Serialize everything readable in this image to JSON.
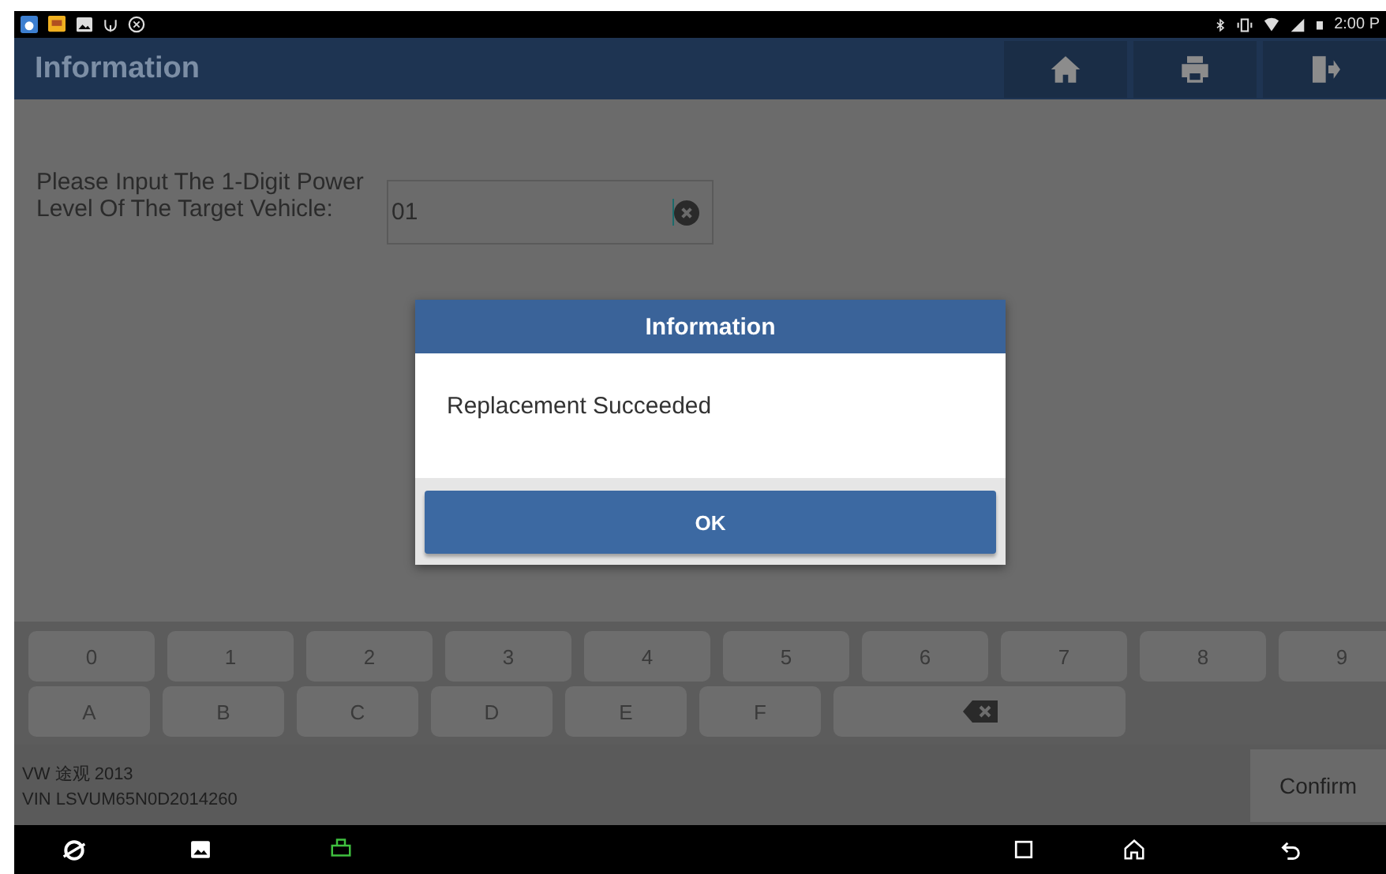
{
  "status_bar": {
    "time": "2:00 P"
  },
  "header": {
    "title": "Information"
  },
  "prompt": {
    "label": "Please Input The 1-Digit Power Level Of The Target Vehicle:",
    "value": "01"
  },
  "dialog": {
    "title": "Information",
    "message": "Replacement Succeeded",
    "button": "OK"
  },
  "keypad": {
    "rows": [
      [
        {
          "kind": "char",
          "label": "0"
        },
        {
          "kind": "char",
          "label": "1"
        },
        {
          "kind": "char",
          "label": "2"
        },
        {
          "kind": "char",
          "label": "3"
        },
        {
          "kind": "char",
          "label": "4"
        },
        {
          "kind": "char",
          "label": "5"
        },
        {
          "kind": "char",
          "label": "6"
        },
        {
          "kind": "char",
          "label": "7"
        },
        {
          "kind": "char",
          "label": "8"
        },
        {
          "kind": "char",
          "label": "9"
        }
      ],
      [
        {
          "kind": "char",
          "label": "A"
        },
        {
          "kind": "char",
          "label": "B"
        },
        {
          "kind": "char",
          "label": "C"
        },
        {
          "kind": "char",
          "label": "D"
        },
        {
          "kind": "char",
          "label": "E"
        },
        {
          "kind": "char",
          "label": "F"
        },
        {
          "kind": "backspace"
        }
      ]
    ]
  },
  "footer": {
    "vehicle": "VW 途观 2013",
    "vin": "VIN LSVUM65N0D2014260",
    "confirm": "Confirm"
  }
}
